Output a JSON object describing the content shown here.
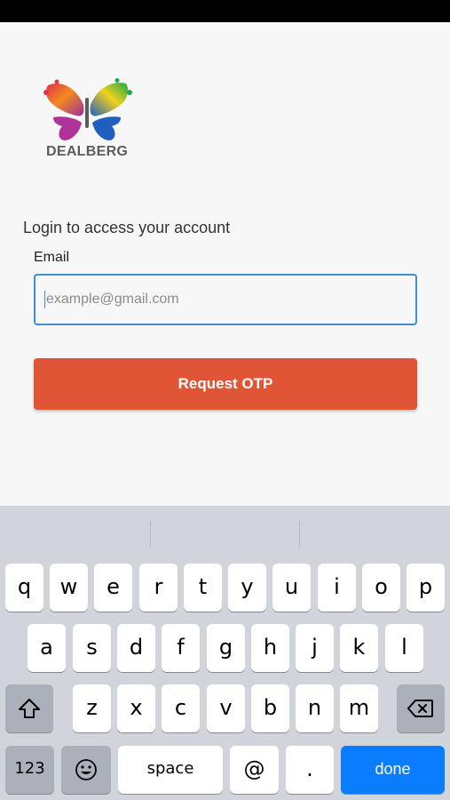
{
  "brand": {
    "name": "DEALBERG"
  },
  "login": {
    "subtitle": "Login to access your account",
    "email_label": "Email",
    "email_placeholder": "example@gmail.com",
    "email_value": "",
    "button_label": "Request OTP"
  },
  "colors": {
    "button": "#e05536",
    "input_border": "#3d8fd6",
    "done_key": "#0a7cff"
  },
  "keyboard": {
    "row1": [
      "q",
      "w",
      "e",
      "r",
      "t",
      "y",
      "u",
      "i",
      "o",
      "p"
    ],
    "row2": [
      "a",
      "s",
      "d",
      "f",
      "g",
      "h",
      "j",
      "k",
      "l"
    ],
    "row3": [
      "z",
      "x",
      "c",
      "v",
      "b",
      "n",
      "m"
    ],
    "num_key": "123",
    "space_key": "space",
    "at_key": "@",
    "dot_key": ".",
    "done_key": "done",
    "shift_icon": "shift-icon",
    "backspace_icon": "backspace-icon",
    "emoji_icon": "emoji-icon"
  }
}
